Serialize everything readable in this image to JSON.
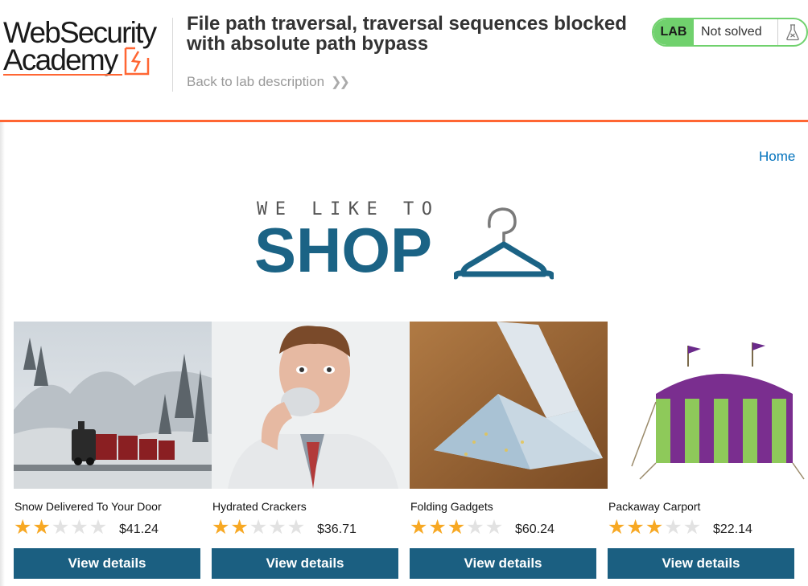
{
  "academy": {
    "logo_line1": "WebSecurity",
    "logo_line2": "Academy",
    "lab_title": "File path traversal, traversal sequences blocked with absolute path bypass",
    "back_link": "Back to lab description",
    "lab_badge": "LAB",
    "lab_status": "Not solved",
    "accent_color": "#ff6633",
    "badge_color": "#70d16d"
  },
  "nav": {
    "home": "Home"
  },
  "banner": {
    "tagline": "WE LIKE TO",
    "word": "SHOP",
    "color": "#1b6385"
  },
  "products": [
    {
      "name": "Snow Delivered To Your Door",
      "rating": 2,
      "price": "$41.24",
      "button": "View details",
      "image": "snowy-steam-train"
    },
    {
      "name": "Hydrated Crackers",
      "rating": 2,
      "price": "$36.71",
      "button": "View details",
      "image": "man-eating-cracker"
    },
    {
      "name": "Folding Gadgets",
      "rating": 3,
      "price": "$60.24",
      "button": "View details",
      "image": "origami-banknote"
    },
    {
      "name": "Packaway Carport",
      "rating": 3,
      "price": "$22.14",
      "button": "View details",
      "image": "striped-tent"
    }
  ],
  "button_color": "#1b5f81",
  "star_color": "#f7a823"
}
